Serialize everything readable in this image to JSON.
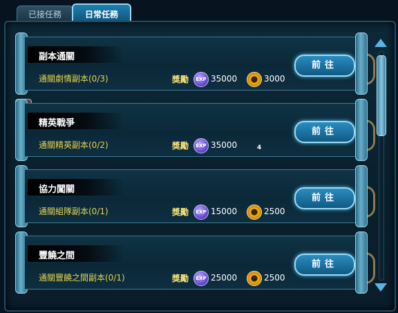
{
  "tabs": {
    "accepted": "已接任務",
    "daily": "日常任務"
  },
  "reward_label": "獎勵",
  "go_label": "前往",
  "quests": [
    {
      "title": "副本通關",
      "desc": "通關劇情副本(0/3)",
      "exp": "35000",
      "second_type": "coin",
      "second_value": "3000"
    },
    {
      "title": "精英戰爭",
      "desc": "通關精英副本(0/2)",
      "exp": "35000",
      "second_type": "hero",
      "second_value": "4"
    },
    {
      "title": "協力闖關",
      "desc": "通關組隊副本(0/1)",
      "exp": "15000",
      "second_type": "coin",
      "second_value": "2500"
    },
    {
      "title": "豐饒之間",
      "desc": "通關豐饒之間副本(0/1)",
      "exp": "25000",
      "second_type": "coin",
      "second_value": "2500"
    }
  ],
  "icons": {
    "exp_icon": "EXP",
    "coin_icon": "coin",
    "hero_icon": "hero-portrait"
  }
}
